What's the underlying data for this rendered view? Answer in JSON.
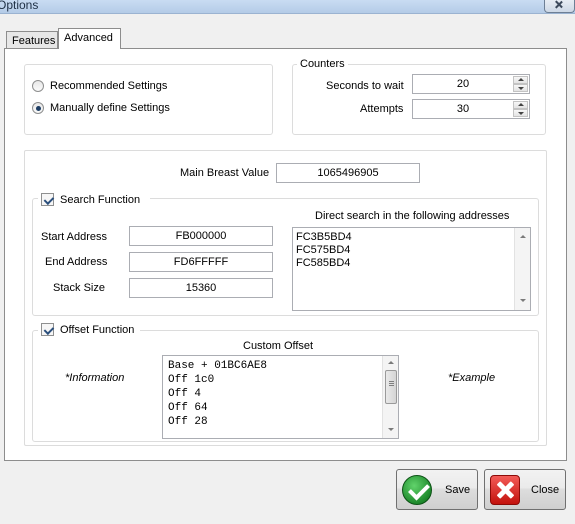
{
  "window": {
    "title": "Options"
  },
  "tabs": [
    {
      "label": "Features",
      "selected": false
    },
    {
      "label": "Advanced",
      "selected": true
    }
  ],
  "settings_mode": {
    "options": [
      {
        "label": "Recommended Settings",
        "checked": false
      },
      {
        "label": "Manually define Settings",
        "checked": true
      }
    ]
  },
  "counters": {
    "legend": "Counters",
    "seconds_to_wait": {
      "label": "Seconds to wait",
      "value": "20"
    },
    "attempts": {
      "label": "Attempts",
      "value": "30"
    }
  },
  "main_value": {
    "label": "Main Breast Value",
    "value": "1065496905"
  },
  "search_function": {
    "label": "Search Function",
    "checked": true,
    "start_address": {
      "label": "Start Address",
      "value": "FB000000"
    },
    "end_address": {
      "label": "End Address",
      "value": "FD6FFFFF"
    },
    "stack_size": {
      "label": "Stack Size",
      "value": "15360"
    },
    "direct_search_label": "Direct search in the following addresses",
    "addresses": [
      "FC3B5BD4",
      "FC575BD4",
      "FC585BD4"
    ]
  },
  "offset_function": {
    "label": "Offset Function",
    "checked": true,
    "custom_offset_label": "Custom Offset",
    "lines": [
      "Base + 01BC6AE8",
      "Off 1c0",
      "Off 4",
      "Off 64",
      "Off 28"
    ],
    "information_label": "*Information",
    "example_label": "*Example"
  },
  "buttons": {
    "save": "Save",
    "close": "Close"
  },
  "colors": {
    "save_icon": "#1e8a2c",
    "close_icon": "#c3120d",
    "tab_border": "#8d8d8d",
    "group_border": "#dcdcdc"
  }
}
